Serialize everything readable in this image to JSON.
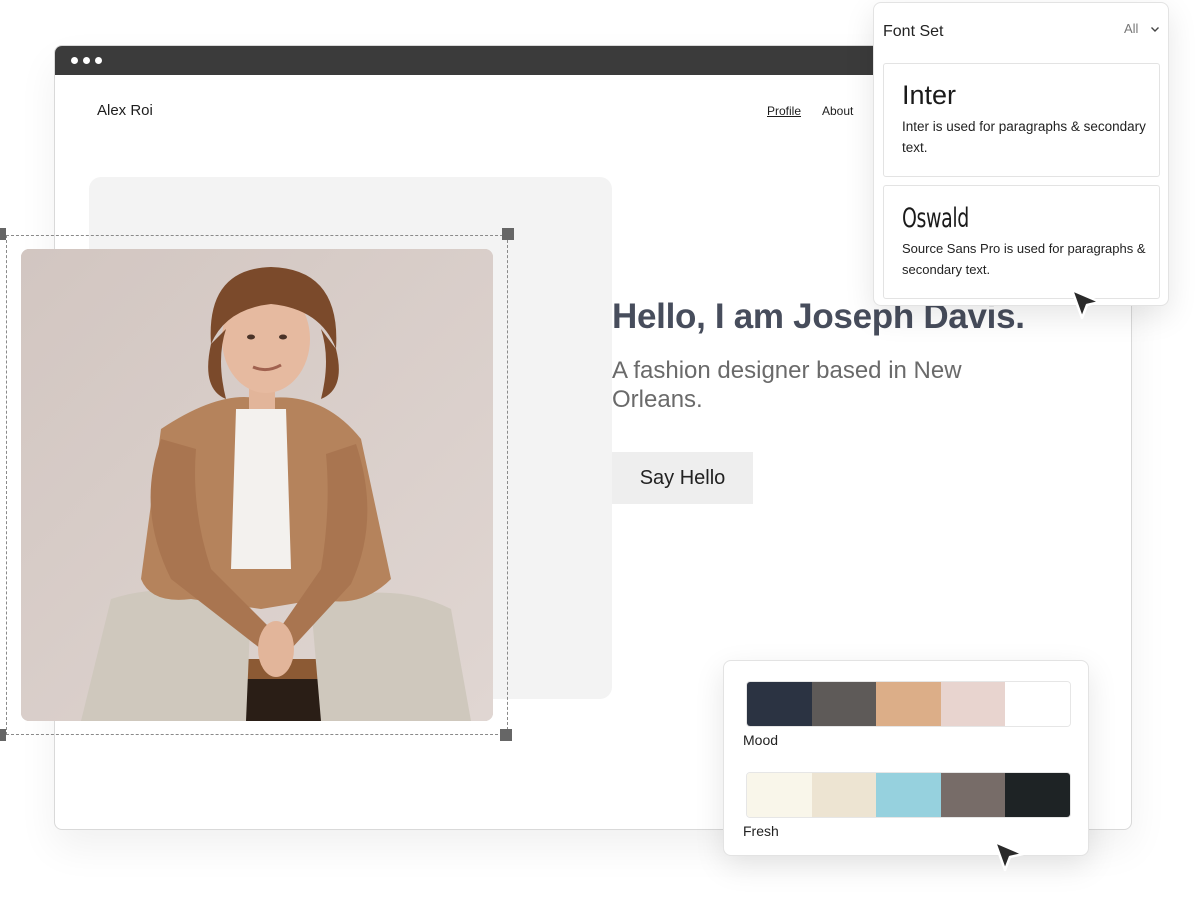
{
  "browser": {
    "site_logo": "Alex Roi",
    "nav": [
      {
        "label": "Profile",
        "active": true
      },
      {
        "label": "About",
        "active": false
      }
    ]
  },
  "hero": {
    "title": "Hello, I am Joseph Davis.",
    "subtitle": "A fashion designer based in New Orleans.",
    "cta_label": "Say Hello"
  },
  "font_panel": {
    "title": "Font Set",
    "filter_value": "All",
    "fonts": [
      {
        "name": "Inter",
        "description": "Inter is used for paragraphs & secondary text."
      },
      {
        "name": "Oswald",
        "description": "Source Sans Pro is used for paragraphs & secondary text."
      }
    ]
  },
  "palettes": [
    {
      "name": "Mood",
      "colors": [
        "#2b3342",
        "#5e5a58",
        "#dcae88",
        "#e8d4cf",
        "#ffffff"
      ]
    },
    {
      "name": "Fresh",
      "colors": [
        "#f9f6ea",
        "#ede4d2",
        "#96d1de",
        "#776c68",
        "#1e2325"
      ]
    }
  ],
  "icons": {
    "window_dots": "window-control-dots-icon",
    "chevron": "chevron-down-icon",
    "cursor": "cursor-arrow-icon"
  }
}
